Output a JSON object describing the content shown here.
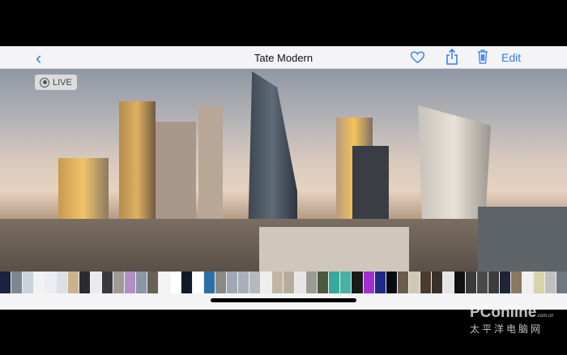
{
  "nav": {
    "back_label": "‹",
    "title": "Tate Modern",
    "edit_label": "Edit",
    "accent": "#2f7cf6"
  },
  "photo": {
    "live_label": "LIVE"
  },
  "thumbnails": [
    "#1a2340",
    "#7d8794",
    "#c8d3de",
    "#f2f2f2",
    "#e9eef3",
    "#dcdfe4",
    "#c9b38d",
    "#2b2c31",
    "#e8ecf1",
    "#3a3a3c",
    "#9e9b96",
    "#b28fc4",
    "#8c96a4",
    "#6a6156",
    "#f4f4f4",
    "#ffffff",
    "#0f1a2a",
    "#ffffff",
    "#2e6ea8",
    "#8a8a84",
    "#9fa8b4",
    "#a7afba",
    "#b5b9bd",
    "#eeeeee",
    "#c2b6a2",
    "#b7ac9c",
    "#e5e5e5",
    "#9c9b93",
    "#4a5a3c",
    "#3aa6a0",
    "#48b0a4",
    "#1a1a1a",
    "#a42fd0",
    "#1f2a8a",
    "#0a0a12",
    "#6b5d4a",
    "#cfc7b5",
    "#4a3b2c",
    "#3a3128",
    "#e5e5e5",
    "#111",
    "#3a3a3a",
    "#4a4a4a",
    "#3c3c3c",
    "#1f2438",
    "#8a7860",
    "#f0f0f0",
    "#d8d4a8",
    "#c0c0c0",
    "#6e7680"
  ],
  "watermark": {
    "brand": "PConline",
    "domain": ".com.cn",
    "cn": "太平洋电脑网"
  }
}
